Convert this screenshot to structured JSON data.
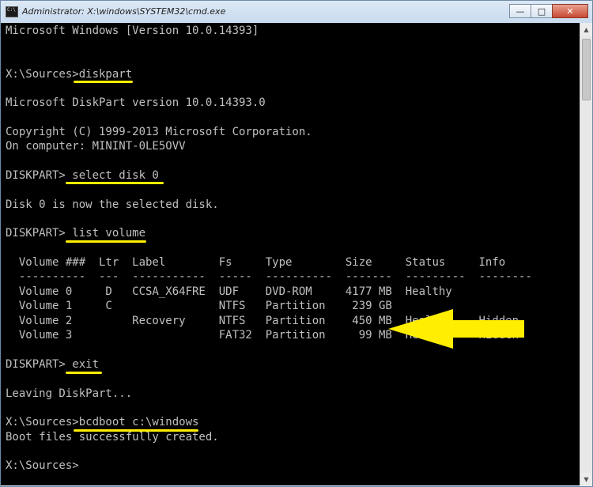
{
  "window": {
    "title": "Administrator: X:\\windows\\SYSTEM32\\cmd.exe",
    "icon_label": "C:\\",
    "controls": {
      "minimize": "—",
      "maximize": "□",
      "close": "✕"
    }
  },
  "console": {
    "lines": [
      "Microsoft Windows [Version 10.0.14393]",
      "",
      "",
      "X:\\Sources>diskpart",
      "",
      "Microsoft DiskPart version 10.0.14393.0",
      "",
      "Copyright (C) 1999-2013 Microsoft Corporation.",
      "On computer: MININT-0LE5OVV",
      "",
      "DISKPART> select disk 0",
      "",
      "Disk 0 is now the selected disk.",
      "",
      "DISKPART> list volume",
      "",
      "  Volume ###  Ltr  Label        Fs     Type        Size     Status     Info",
      "  ----------  ---  -----------  -----  ----------  -------  ---------  --------",
      "  Volume 0     D   CCSA_X64FRE  UDF    DVD-ROM     4177 MB  Healthy",
      "  Volume 1     C                NTFS   Partition    239 GB",
      "  Volume 2         Recovery     NTFS   Partition    450 MB  Healthy    Hidden",
      "  Volume 3                      FAT32  Partition     99 MB  Healthy    Hidden",
      "",
      "DISKPART> exit",
      "",
      "Leaving DiskPart...",
      "",
      "X:\\Sources>bcdboot c:\\windows",
      "Boot files successfully created.",
      "",
      "X:\\Sources>"
    ]
  },
  "colors": {
    "console_text": "#c0c0c0",
    "console_bg": "#000000",
    "highlight": "#ffee00"
  },
  "annotation": {
    "arrow_icon": "left-arrow-icon"
  }
}
